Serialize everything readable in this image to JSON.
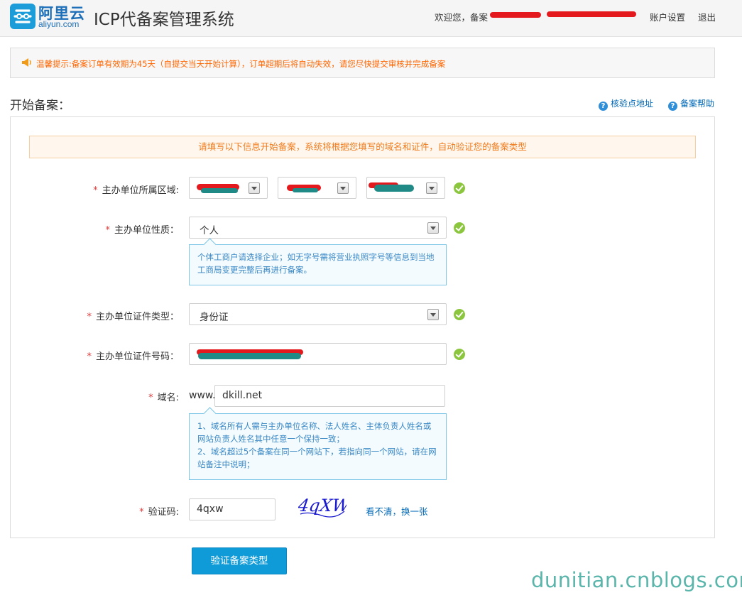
{
  "header": {
    "logo_cn": "阿里云",
    "logo_en": "aliyun.com",
    "title": "ICP代备案管理系统",
    "welcome": "欢迎您，备案",
    "account_settings": "账户设置",
    "logout": "退出"
  },
  "tip": {
    "text": "温馨提示:备案订单有效期为45天（自提交当天开始计算），订单超期后将自动失效，请您尽快提交审核并完成备案"
  },
  "section": {
    "title": "开始备案：",
    "links": [
      "核验点地址",
      "备案帮助"
    ]
  },
  "form": {
    "notice": "请填写以下信息开始备案，系统将根据您填写的域名和证件，自动验证您的备案类型",
    "region_label": "主办单位所属区域:",
    "nature_label": "主办单位性质：",
    "nature_value": "个人",
    "nature_hint": "个体工商户请选择企业；如无字号需将营业执照字号等信息到当地工商局变更完整后再进行备案。",
    "cert_type_label": "主办单位证件类型：",
    "cert_type_value": "身份证",
    "cert_no_label": "主办单位证件号码：",
    "domain_label": "域名:",
    "domain_prefix": "www.",
    "domain_value": "dkill.net",
    "domain_hint_1": "1、域名所有人需与主办单位名称、法人姓名、主体负责人姓名或网站负责人姓名其中任意一个保持一致；",
    "domain_hint_2": "2、域名超过5个备案在同一个网站下，若指向同一个网站，请在网站备注中说明；",
    "captcha_label": "验证码:",
    "captcha_value": "4qxw",
    "captcha_image_text": "4qXW",
    "refresh_label": "看不清，换一张",
    "submit_label": "验证备案类型"
  },
  "watermark": "dunitian.cnblogs.com",
  "colors": {
    "accent": "#0f9ad8",
    "warning": "#ff6600",
    "success": "#8cc63e",
    "required": "#e23b3b",
    "redact_red": "#e3191e",
    "redact_teal": "#1f8a86"
  },
  "icons": [
    "aliyun-logo-icon",
    "speaker-icon",
    "question-icon",
    "check-icon",
    "chevron-down-icon"
  ]
}
